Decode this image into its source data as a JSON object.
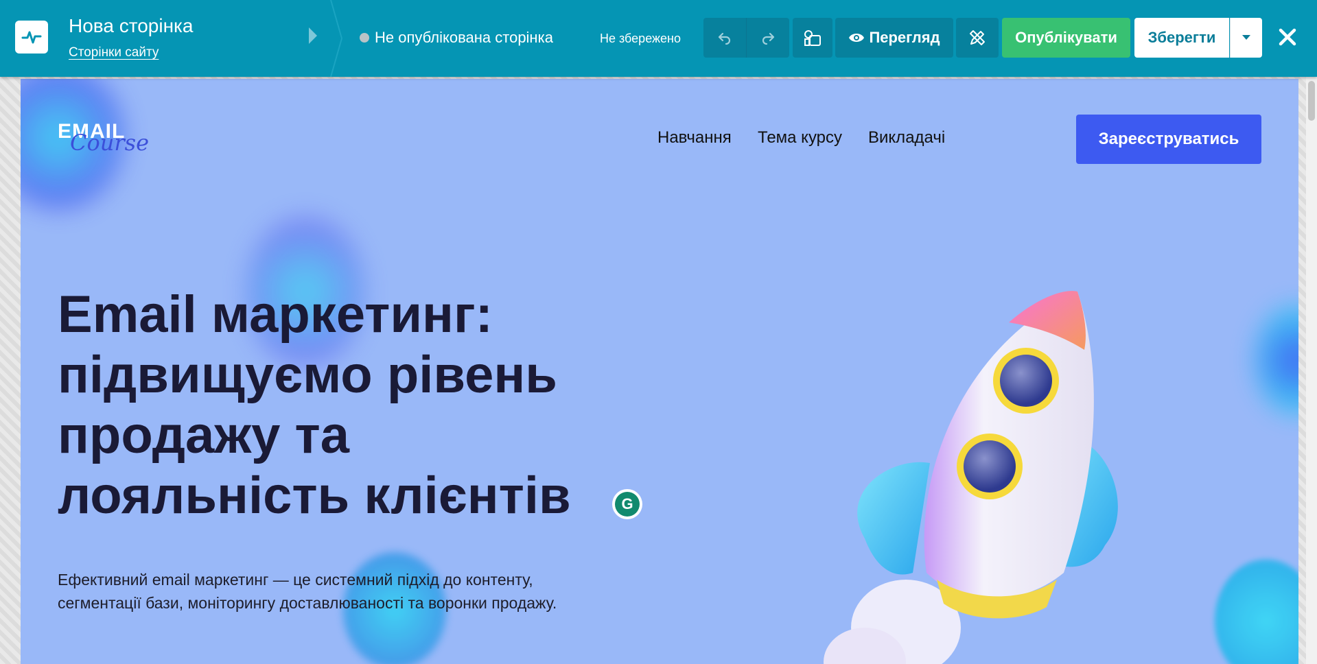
{
  "editor": {
    "page_title": "Нова сторінка",
    "pages_link": "Сторінки сайту",
    "status": "Не опублікована сторінка",
    "save_state": "Не збережено",
    "preview_label": "Перегляд",
    "publish_label": "Опублікувати",
    "save_label": "Зберегти",
    "colors": {
      "toolbar": "#0595b4",
      "publish": "#38c172"
    }
  },
  "site": {
    "logo": {
      "main": "EMAIL",
      "script": "Course"
    },
    "nav": [
      "Навчання",
      "Тема курсу",
      "Викладачі"
    ],
    "cta": "Зареєструватись",
    "hero": {
      "title_lines": [
        "Email маркетинг:",
        "підвищуємо рівень",
        "продажу та",
        "лояльність клієнтів"
      ],
      "subtitle_lines": [
        "Ефективний email маркетинг — це системний підхід до контенту,",
        "сегментації бази, моніторингу доставлюваності та воронки продажу."
      ]
    },
    "colors": {
      "background": "#99b8f8",
      "cta": "#3d5af1",
      "title": "#1a1a36"
    }
  },
  "icons": {
    "grammarly": "G"
  }
}
